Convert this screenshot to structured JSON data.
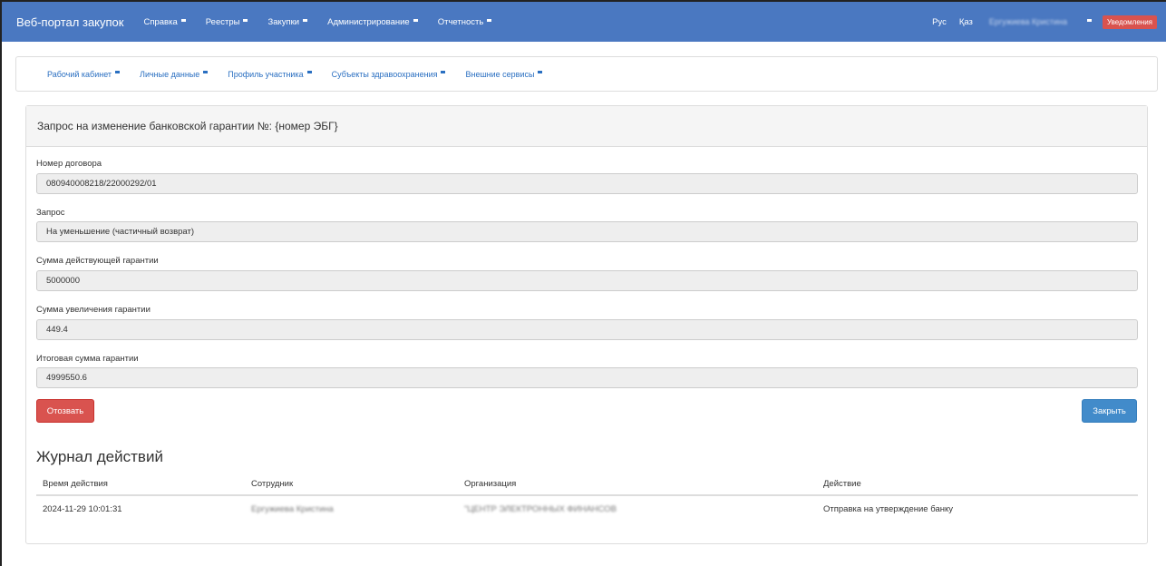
{
  "navbar": {
    "brand": "Веб-портал закупок",
    "items": [
      {
        "label": "Справка"
      },
      {
        "label": "Реестры"
      },
      {
        "label": "Закупки"
      },
      {
        "label": "Администрирование"
      },
      {
        "label": "Отчетность"
      }
    ],
    "lang_ru": "Рус",
    "lang_kz": "Қаз",
    "user": "Ергужиева Кристина",
    "notifications": "Уведомления"
  },
  "subnav": {
    "items": [
      {
        "label": "Рабочий кабинет"
      },
      {
        "label": "Личные данные"
      },
      {
        "label": "Профиль участника"
      },
      {
        "label": "Субъекты здравоохранения"
      },
      {
        "label": "Внешние сервисы"
      }
    ]
  },
  "panel": {
    "title": "Запрос на изменение банковской гарантии №: {номер ЭБГ}",
    "fields": [
      {
        "label": "Номер договора",
        "value": "080940008218/22000292/01"
      },
      {
        "label": "Запрос",
        "value": "На уменьшение (частичный возврат)"
      },
      {
        "label": "Сумма действующей гарантии",
        "value": "5000000"
      },
      {
        "label": "Сумма увеличения гарантии",
        "value": "449.4"
      },
      {
        "label": "Итоговая сумма гарантии",
        "value": "4999550.6"
      }
    ],
    "revoke_label": "Отозвать",
    "close_label": "Закрыть"
  },
  "log": {
    "title": "Журнал действий",
    "headers": [
      "Время действия",
      "Сотрудник",
      "Организация",
      "Действие"
    ],
    "rows": [
      [
        "2024-11-29 10:01:31",
        "Ергужиева Кристина",
        "\"ЦЕНТР ЭЛЕКТРОННЫХ ФИНАНСОВ",
        "Отправка на утверждение банку"
      ]
    ]
  },
  "colors": {
    "navbar": "#4a78c1",
    "link": "#2a6fc1",
    "danger": "#d9534f",
    "primary": "#428bca"
  }
}
